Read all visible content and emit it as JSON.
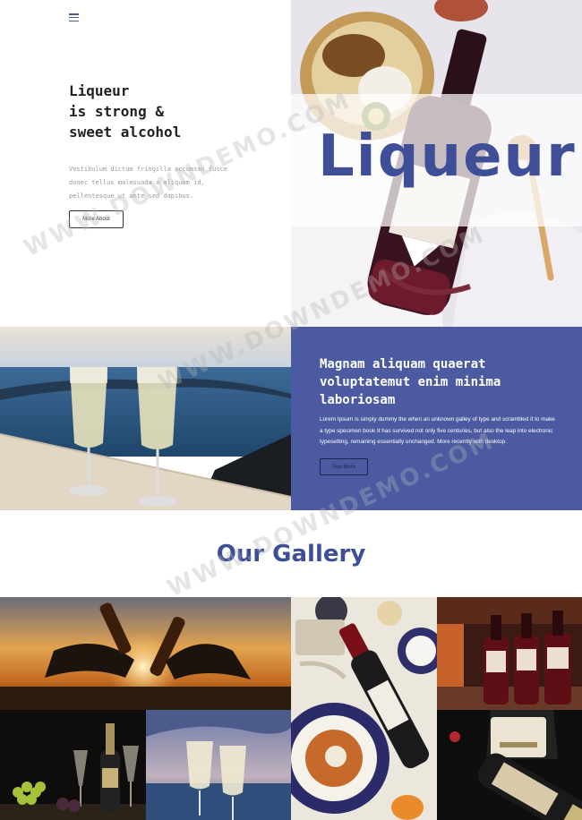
{
  "nav": {
    "menu_icon": "hamburger-menu-icon"
  },
  "hero": {
    "title": "Liqueur\nis strong &\nsweet alcohol",
    "text": "Vestibulum dictum fringilla accumsan fusce donec tellus malesuada a aliquam id, pellentesque ut ante sed dapibus.",
    "button_label": "More About",
    "overlay_word": "Liqueur"
  },
  "feature": {
    "title": "Magnam aliquam quaerat voluptatemut enim minima laboriosam",
    "text": "Lorem Ipsum is simply dummy the when an unknown galley of type and scrambled it to make a type specimen book It has survived not only five centuries, but also the leap into electronic typesetting, remaining essentially unchanged. More recently with desktop.",
    "button_label": "See More"
  },
  "gallery": {
    "heading": "Our Gallery"
  },
  "watermark": "WWW.DOWNDEMO.COM",
  "colors": {
    "brand_blue": "#4c5ba1",
    "heading_blue": "#3e4f98",
    "text_dark": "#222222"
  }
}
